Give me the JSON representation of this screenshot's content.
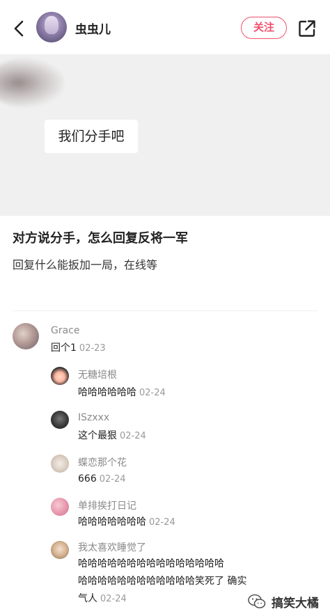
{
  "header": {
    "username": "虫虫儿",
    "follow_label": "关注",
    "back_icon": "chevron-left-icon",
    "share_icon": "share-external-icon"
  },
  "post": {
    "image_text": "我们分手吧",
    "title": "对方说分手，怎么回复反将一军",
    "body": "回复什么能扳加一局，在线等"
  },
  "comments": [
    {
      "name": "Grace",
      "text": "回个1",
      "date": "02-23"
    },
    {
      "name": "无糖培根",
      "text": "哈哈哈哈哈哈",
      "date": "02-24"
    },
    {
      "name": "ISzxxx",
      "text": "这个最狠",
      "date": "02-24"
    },
    {
      "name": "蝶恋那个花",
      "text": "666",
      "date": "02-24"
    },
    {
      "name": "单排挨打日记",
      "text": "哈哈哈哈哈哈哈",
      "date": "02-24"
    },
    {
      "name": "我太喜欢睡觉了",
      "text_line1": "哈哈哈哈哈哈哈哈哈哈哈哈哈哈哈",
      "text_line2": "哈哈哈哈哈哈哈哈哈哈哈哈笑死了 确实",
      "text_line3": "气人",
      "date": "02-24"
    }
  ],
  "watermark": {
    "text": "搞笑大橘",
    "icon": "wechat-icon"
  },
  "colors": {
    "accent": "#f0506e",
    "muted": "#8a8a8a",
    "image_bg": "#f0f0f0"
  }
}
